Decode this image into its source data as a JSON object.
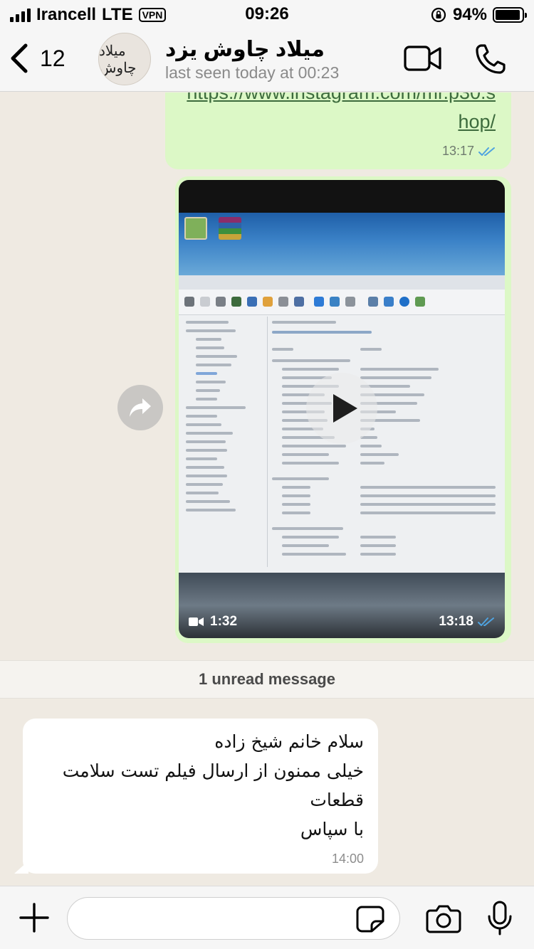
{
  "status_bar": {
    "carrier": "Irancell",
    "network": "LTE",
    "vpn": "VPN",
    "time": "09:26",
    "battery": "94%",
    "battery_level": 0.94
  },
  "header": {
    "back_count": "12",
    "avatar_text": "میلاد چاوش",
    "contact_name": "میلاد چاوش یزد",
    "last_seen": "last seen today at 00:23",
    "icons": [
      "chevron-left-icon",
      "video-call-icon",
      "phone-icon"
    ]
  },
  "messages": {
    "link": {
      "text": "https://www.instagram.com/mr.p30.shop/",
      "time": "13:17",
      "status": "read"
    },
    "video": {
      "duration": "1:32",
      "time": "13:18",
      "status": "read"
    },
    "unread_divider": "1 unread message",
    "incoming": {
      "lines": [
        "سلام خانم شیخ زاده",
        "خیلی ممنون از ارسال فیلم تست سلامت",
        "قطعات",
        "با سپاس"
      ],
      "time": "14:00"
    }
  },
  "input_bar": {
    "placeholder": "",
    "icons": [
      "plus-icon",
      "sticker-icon",
      "camera-icon",
      "microphone-icon"
    ]
  },
  "colors": {
    "outgoing_bubble": "#dcf8c6",
    "incoming_bubble": "#ffffff",
    "chat_background": "#efeae2",
    "read_ticks": "#4fa3e0",
    "link": "#3d6b3d"
  }
}
